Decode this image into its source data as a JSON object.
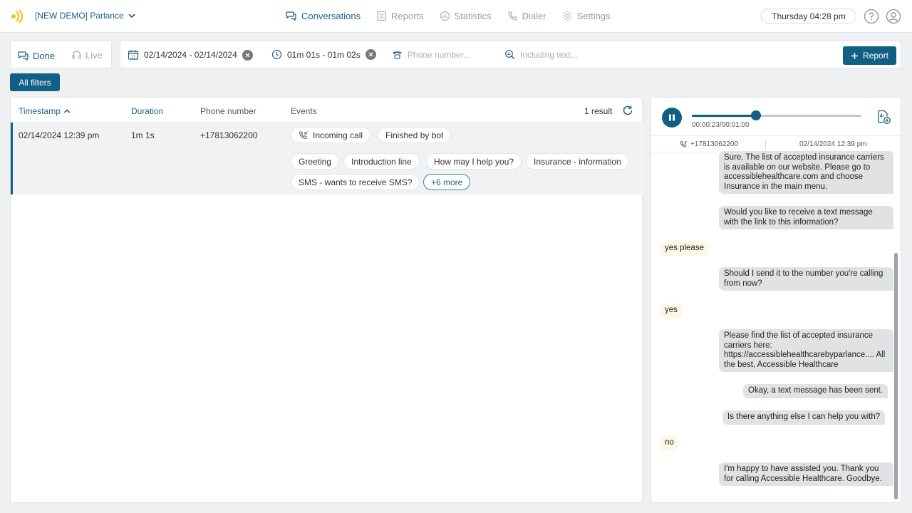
{
  "app": {
    "org_label": "[NEW DEMO] Parlance",
    "time": "Thursday 04:28 pm"
  },
  "nav": [
    {
      "label": "Conversations",
      "active": true
    },
    {
      "label": "Reports"
    },
    {
      "label": "Statistics"
    },
    {
      "label": "Dialer"
    },
    {
      "label": "Settings"
    }
  ],
  "modes": {
    "done": "Done",
    "live": "Live"
  },
  "filters": {
    "date_range": "02/14/2024 - 02/14/2024",
    "duration_range": "01m 01s - 01m 02s",
    "phone_placeholder": "Phone number...",
    "text_placeholder": "Including text...",
    "report_button": "Report",
    "all_filters_button": "All filters"
  },
  "table": {
    "headers": {
      "timestamp": "Timestamp",
      "duration": "Duration",
      "phone": "Phone number",
      "events": "Events"
    },
    "result_count": "1 result",
    "rows": [
      {
        "timestamp": "02/14/2024 12:39 pm",
        "duration": "1m 1s",
        "phone": "+17813062200",
        "events": [
          "Incoming call",
          "Finished by bot",
          "Greeting",
          "Introduction line",
          "How may I help you?",
          "Insurance - information",
          "SMS - wants to receive SMS?"
        ],
        "more": "+6 more"
      }
    ]
  },
  "player": {
    "time": "00:00:23/00:01:00",
    "progress": 0.38,
    "phone": "+17813062200",
    "date": "02/14/2024 12:39 pm"
  },
  "messages": [
    {
      "from": "bot",
      "text": "Sure. The list of accepted insurance carriers is available on our website. Please go to accessiblehealthcare.com and choose Insurance in the main menu."
    },
    {
      "from": "bot",
      "text": "Would you like to receive a text message with the link to this information?"
    },
    {
      "from": "user",
      "text": "yes please"
    },
    {
      "from": "bot",
      "text": "Should I send it to the number you're calling from now?"
    },
    {
      "from": "user",
      "text": "yes"
    },
    {
      "from": "bot",
      "text": "Please find the list of accepted insurance carriers here: https://accessiblehealthcarebyparlance.... All the best, Accessible Healthcare"
    },
    {
      "from": "bot",
      "text": "Okay, a text message has been sent."
    },
    {
      "from": "bot",
      "text": "Is there anything else I can help you with?"
    },
    {
      "from": "user",
      "text": "no"
    },
    {
      "from": "bot",
      "text": "I'm happy to have assisted you. Thank you for calling Accessible Healthcare. Goodbye."
    }
  ],
  "colors": {
    "accent": "#125f86",
    "bot_bubble": "#e1e2e4",
    "user_bubble": "#fdf8e3",
    "logo": "#f2c318"
  }
}
